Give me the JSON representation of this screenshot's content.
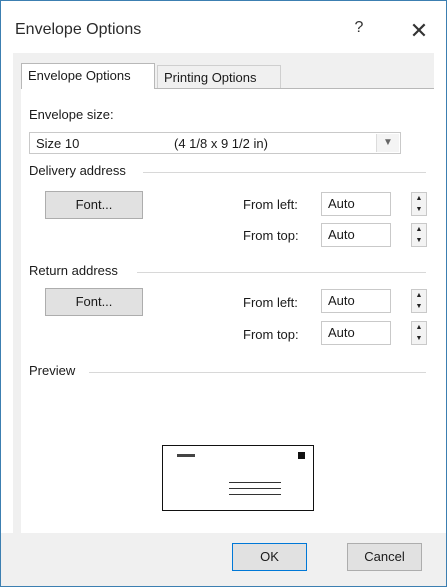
{
  "window": {
    "title": "Envelope Options",
    "help_label": "?",
    "close_label": "✕"
  },
  "tabs": [
    {
      "label": "Envelope Options",
      "active": true
    },
    {
      "label": "Printing Options",
      "active": false
    }
  ],
  "envelope_size": {
    "label": "Envelope size:",
    "selected_name": "Size 10",
    "selected_dimensions": "(4 1/8 x 9 1/2 in)",
    "dropdown_icon": "chevron-down-icon"
  },
  "delivery_address": {
    "section_label": "Delivery address",
    "font_button": "Font...",
    "from_left_label": "From left:",
    "from_left_value": "Auto",
    "from_top_label": "From top:",
    "from_top_value": "Auto"
  },
  "return_address": {
    "section_label": "Return address",
    "font_button": "Font...",
    "from_left_label": "From left:",
    "from_left_value": "Auto",
    "from_top_label": "From top:",
    "from_top_value": "Auto"
  },
  "preview": {
    "section_label": "Preview"
  },
  "footer": {
    "ok_label": "OK",
    "cancel_label": "Cancel"
  },
  "colors": {
    "window_border": "#3c7fb1",
    "dialog_background": "#f0f0f0",
    "panel_background": "#ffffff",
    "ok_focus_border": "#0078d7"
  },
  "spinner_icons": {
    "up": "triangle-up-icon",
    "down": "triangle-down-icon"
  }
}
